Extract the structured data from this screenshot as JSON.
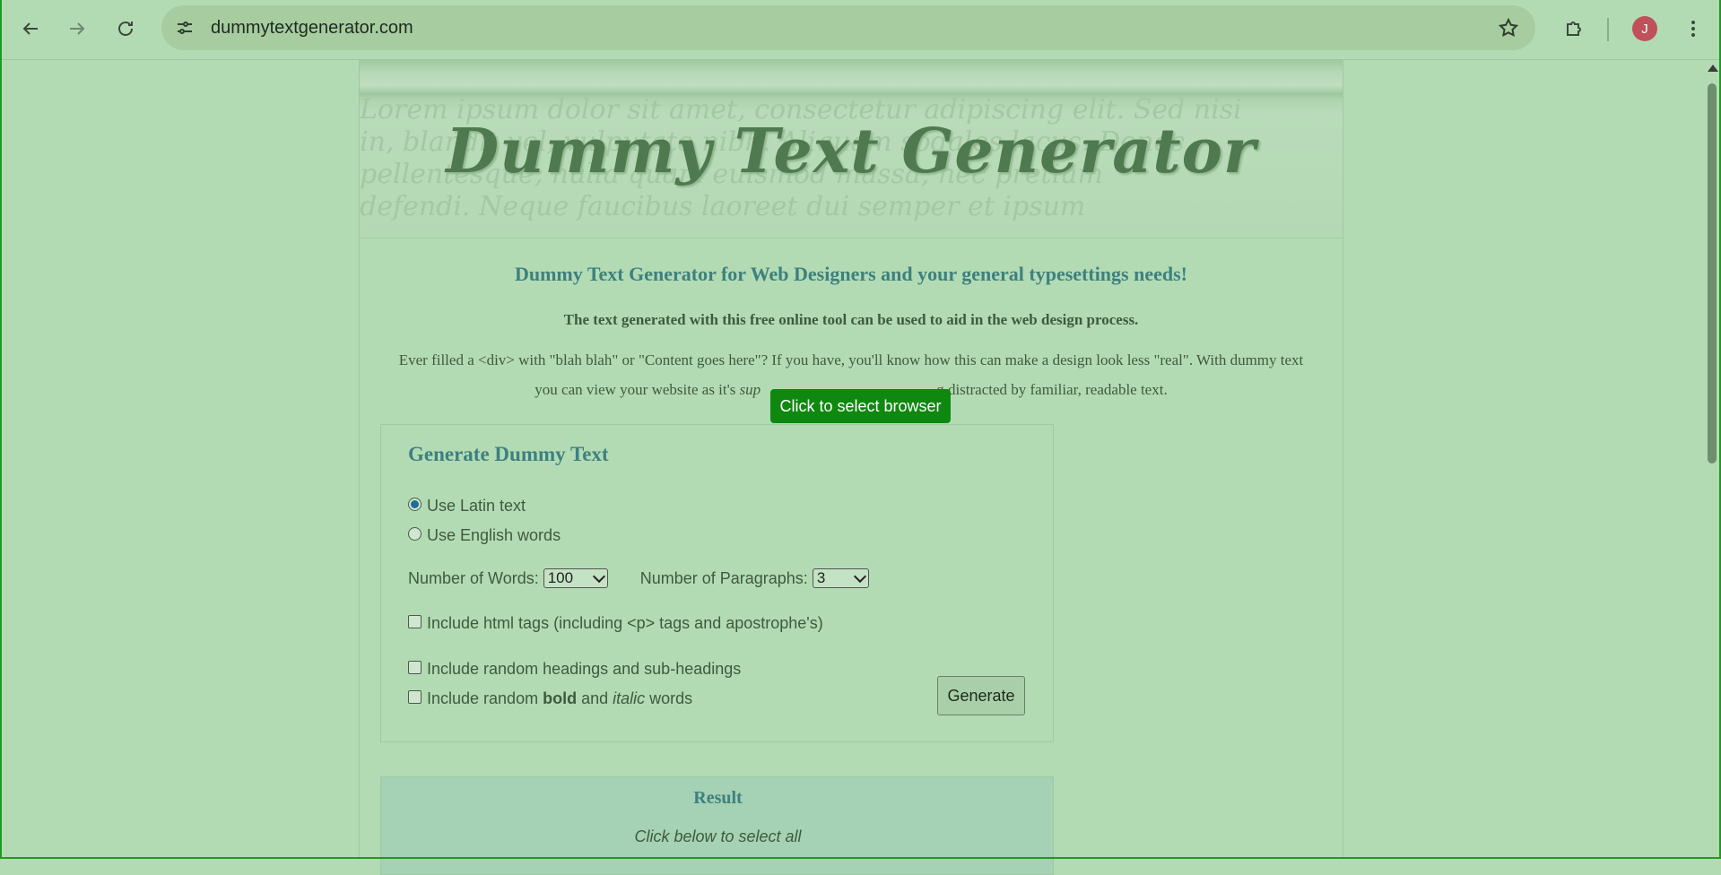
{
  "browser": {
    "url": "dummytextgenerator.com",
    "profile_initial": "J",
    "icons": {
      "back": "arrow-left-icon",
      "forward": "arrow-right-icon",
      "reload": "reload-icon",
      "site_info": "tune-icon",
      "bookmark": "star-icon",
      "extensions": "puzzle-icon",
      "menu": "kebab-menu-icon"
    }
  },
  "banner": {
    "title": "Dummy Text Generator",
    "background_lines": [
      "Lorem ipsum dolor sit amet, consectetur adipiscing elit. Sed nisi",
      "in, blandit vel, vulputate nibh. Aliquam sodales lacus. Donec",
      "pellentesque, nulla quam euismod massa, nec pretium",
      "defendi. Neque faucibus laoreet dui semper et ipsum"
    ]
  },
  "intro": {
    "heading": "Dummy Text Generator for Web Designers and your general typesettings needs!",
    "subheading": "The text generated with this free online tool can be used to aid in the web design process.",
    "para_part1": "Ever filled a <div> with \"blah blah\" or \"Content goes here\"? If you have, you'll know how this can make a design look less \"real\". With dummy text you can view your website as it's ",
    "para_italic": "sup",
    "para_part2": "g distracted by familiar, readable text."
  },
  "generator": {
    "title": "Generate Dummy Text",
    "radio_latin": "Use Latin text",
    "radio_english": "Use English words",
    "selected_mode": "latin",
    "words_label": "Number of Words:",
    "words_value": "100",
    "paragraphs_label": "Number of Paragraphs:",
    "paragraphs_value": "3",
    "html_tags_label": "Include html tags (including <p> tags and apostrophe's)",
    "headings_label": "Include random headings and sub-headings",
    "bold_italic_prefix": "Include random ",
    "bold_word": "bold",
    "and_word": " and ",
    "italic_word": "italic",
    "words_suffix": " words",
    "generate_button": "Generate"
  },
  "result": {
    "title": "Result",
    "hint": "Click below to select all"
  },
  "tooltip": {
    "text": "Click to select browser"
  }
}
